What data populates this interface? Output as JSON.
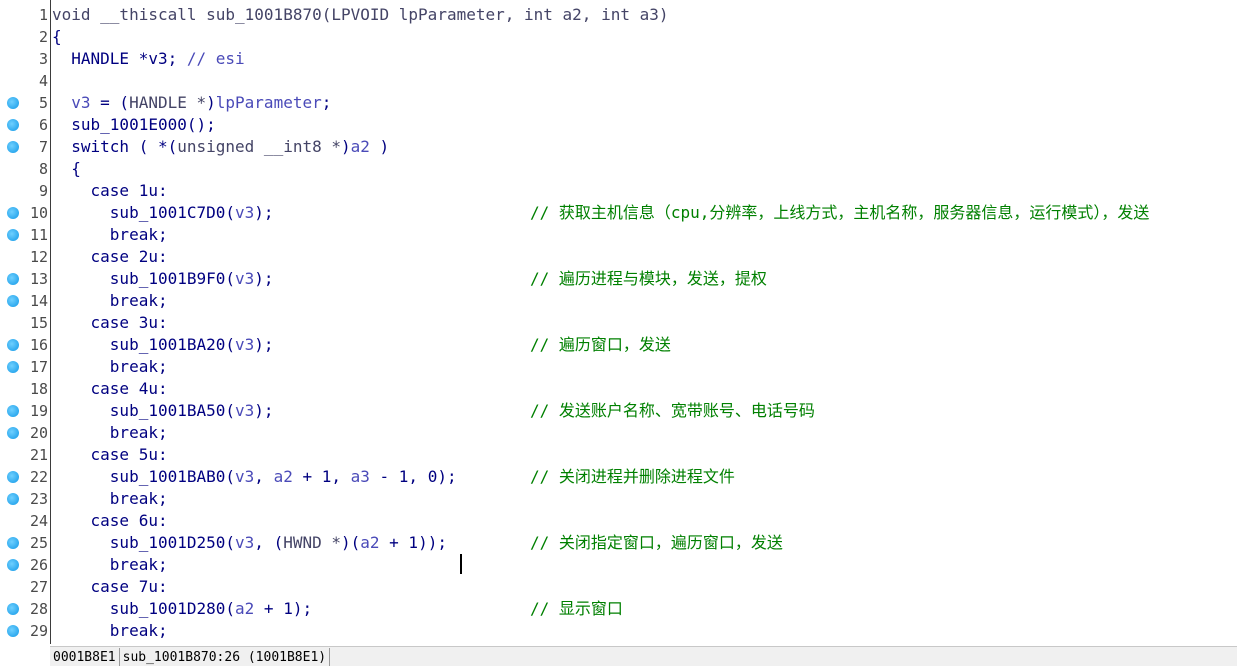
{
  "lines": [
    {
      "num": "1",
      "bp": false,
      "tokens": [
        {
          "t": "void __thiscall sub_1001B870(LPVOID lpParameter, int a2, int a3)",
          "c": "type"
        }
      ],
      "comment": ""
    },
    {
      "num": "2",
      "bp": false,
      "tokens": [
        {
          "t": "{",
          "c": "plain"
        }
      ],
      "comment": ""
    },
    {
      "num": "3",
      "bp": false,
      "tokens": [
        {
          "t": "  HANDLE *v3; ",
          "c": "plain"
        },
        {
          "t": "// esi",
          "c": "var"
        }
      ],
      "comment": ""
    },
    {
      "num": "4",
      "bp": false,
      "tokens": [],
      "comment": ""
    },
    {
      "num": "5",
      "bp": true,
      "tokens": [
        {
          "t": "  ",
          "c": "plain"
        },
        {
          "t": "v3",
          "c": "var"
        },
        {
          "t": " = (",
          "c": "plain"
        },
        {
          "t": "HANDLE *",
          "c": "type"
        },
        {
          "t": ")",
          "c": "plain"
        },
        {
          "t": "lpParameter",
          "c": "var"
        },
        {
          "t": ";",
          "c": "plain"
        }
      ],
      "comment": ""
    },
    {
      "num": "6",
      "bp": true,
      "tokens": [
        {
          "t": "  sub_1001E000();",
          "c": "plain"
        }
      ],
      "comment": ""
    },
    {
      "num": "7",
      "bp": true,
      "tokens": [
        {
          "t": "  switch ( *(",
          "c": "plain"
        },
        {
          "t": "unsigned __int8 *",
          "c": "type"
        },
        {
          "t": ")",
          "c": "plain"
        },
        {
          "t": "a2",
          "c": "var"
        },
        {
          "t": " )",
          "c": "plain"
        }
      ],
      "comment": ""
    },
    {
      "num": "8",
      "bp": false,
      "tokens": [
        {
          "t": "  {",
          "c": "plain"
        }
      ],
      "comment": ""
    },
    {
      "num": "9",
      "bp": false,
      "tokens": [
        {
          "t": "    case 1u:",
          "c": "plain"
        }
      ],
      "comment": ""
    },
    {
      "num": "10",
      "bp": true,
      "tokens": [
        {
          "t": "      sub_1001C7D0(",
          "c": "plain"
        },
        {
          "t": "v3",
          "c": "var"
        },
        {
          "t": ");",
          "c": "plain"
        }
      ],
      "comment": "// 获取主机信息（cpu,分辨率，上线方式，主机名称，服务器信息，运行模式），发送"
    },
    {
      "num": "11",
      "bp": true,
      "tokens": [
        {
          "t": "      break;",
          "c": "plain"
        }
      ],
      "comment": ""
    },
    {
      "num": "12",
      "bp": false,
      "tokens": [
        {
          "t": "    case 2u:",
          "c": "plain"
        }
      ],
      "comment": ""
    },
    {
      "num": "13",
      "bp": true,
      "tokens": [
        {
          "t": "      sub_1001B9F0(",
          "c": "plain"
        },
        {
          "t": "v3",
          "c": "var"
        },
        {
          "t": ");",
          "c": "plain"
        }
      ],
      "comment": "// 遍历进程与模块，发送，提权"
    },
    {
      "num": "14",
      "bp": true,
      "tokens": [
        {
          "t": "      break;",
          "c": "plain"
        }
      ],
      "comment": ""
    },
    {
      "num": "15",
      "bp": false,
      "tokens": [
        {
          "t": "    case 3u:",
          "c": "plain"
        }
      ],
      "comment": ""
    },
    {
      "num": "16",
      "bp": true,
      "tokens": [
        {
          "t": "      sub_1001BA20(",
          "c": "plain"
        },
        {
          "t": "v3",
          "c": "var"
        },
        {
          "t": ");",
          "c": "plain"
        }
      ],
      "comment": "// 遍历窗口，发送"
    },
    {
      "num": "17",
      "bp": true,
      "tokens": [
        {
          "t": "      break;",
          "c": "plain"
        }
      ],
      "comment": ""
    },
    {
      "num": "18",
      "bp": false,
      "tokens": [
        {
          "t": "    case 4u:",
          "c": "plain"
        }
      ],
      "comment": ""
    },
    {
      "num": "19",
      "bp": true,
      "tokens": [
        {
          "t": "      sub_1001BA50(",
          "c": "plain"
        },
        {
          "t": "v3",
          "c": "var"
        },
        {
          "t": ");",
          "c": "plain"
        }
      ],
      "comment": "// 发送账户名称、宽带账号、电话号码"
    },
    {
      "num": "20",
      "bp": true,
      "tokens": [
        {
          "t": "      break;",
          "c": "plain"
        }
      ],
      "comment": ""
    },
    {
      "num": "21",
      "bp": false,
      "tokens": [
        {
          "t": "    case 5u:",
          "c": "plain"
        }
      ],
      "comment": ""
    },
    {
      "num": "22",
      "bp": true,
      "tokens": [
        {
          "t": "      sub_1001BAB0(",
          "c": "plain"
        },
        {
          "t": "v3",
          "c": "var"
        },
        {
          "t": ", ",
          "c": "plain"
        },
        {
          "t": "a2",
          "c": "var"
        },
        {
          "t": " + 1, ",
          "c": "plain"
        },
        {
          "t": "a3",
          "c": "var"
        },
        {
          "t": " - 1, 0);",
          "c": "plain"
        }
      ],
      "comment": "// 关闭进程并删除进程文件"
    },
    {
      "num": "23",
      "bp": true,
      "tokens": [
        {
          "t": "      break;",
          "c": "plain"
        }
      ],
      "comment": ""
    },
    {
      "num": "24",
      "bp": false,
      "tokens": [
        {
          "t": "    case 6u:",
          "c": "plain"
        }
      ],
      "comment": ""
    },
    {
      "num": "25",
      "bp": true,
      "tokens": [
        {
          "t": "      sub_1001D250(",
          "c": "plain"
        },
        {
          "t": "v3",
          "c": "var"
        },
        {
          "t": ", (",
          "c": "plain"
        },
        {
          "t": "HWND *",
          "c": "type"
        },
        {
          "t": ")(",
          "c": "plain"
        },
        {
          "t": "a2",
          "c": "var"
        },
        {
          "t": " + 1));",
          "c": "plain"
        }
      ],
      "comment": "// 关闭指定窗口，遍历窗口，发送"
    },
    {
      "num": "26",
      "bp": true,
      "tokens": [
        {
          "t": "      break;",
          "c": "plain"
        }
      ],
      "comment": ""
    },
    {
      "num": "27",
      "bp": false,
      "tokens": [
        {
          "t": "    case 7u:",
          "c": "plain"
        }
      ],
      "comment": ""
    },
    {
      "num": "28",
      "bp": true,
      "tokens": [
        {
          "t": "      sub_1001D280(",
          "c": "plain"
        },
        {
          "t": "a2",
          "c": "var"
        },
        {
          "t": " + 1);",
          "c": "plain"
        }
      ],
      "comment": "// 显示窗口"
    },
    {
      "num": "29",
      "bp": true,
      "tokens": [
        {
          "t": "      break;",
          "c": "plain"
        }
      ],
      "comment": ""
    }
  ],
  "status": {
    "address": "0001B8E1",
    "location": "sub_1001B870:26 (1001B8E1)"
  },
  "colors": {
    "plain": "#000080",
    "type": "#444466",
    "var": "#4a4ab8",
    "comment": "#008000",
    "breakpoint": "#2ea9ee"
  }
}
